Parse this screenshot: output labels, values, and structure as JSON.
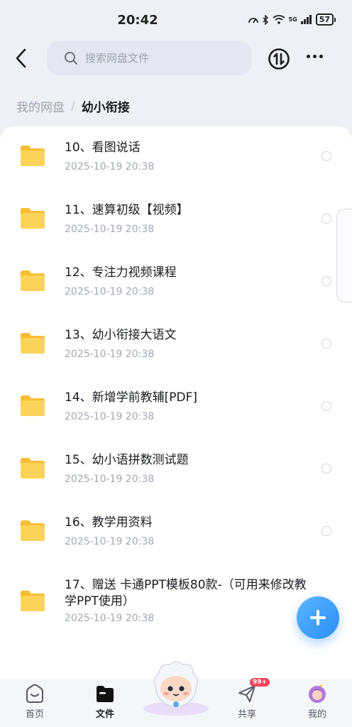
{
  "status": {
    "time": "20:42",
    "battery": "57",
    "network": "5G"
  },
  "search": {
    "placeholder": "搜索网盘文件"
  },
  "breadcrumb": {
    "root": "我的网盘",
    "separator": "/",
    "current": "幼小衔接"
  },
  "files": [
    {
      "name": "10、看图说话",
      "date": "2025-10-19  20:38"
    },
    {
      "name": "11、速算初级【视频】",
      "date": "2025-10-19  20:38"
    },
    {
      "name": "12、专注力视频课程",
      "date": "2025-10-19  20:38"
    },
    {
      "name": "13、幼小衔接大语文",
      "date": "2025-10-19  20:38"
    },
    {
      "name": "14、新增学前教辅[PDF]",
      "date": "2025-10-19  20:38"
    },
    {
      "name": "15、幼小语拼数测试题",
      "date": "2025-10-19  20:38"
    },
    {
      "name": "16、教学用资料",
      "date": "2025-10-19  20:38"
    },
    {
      "name": "17、赠送   卡通PPT模板80款-（可用来修改教学PPT使用）",
      "date": "2025-10-19  20:38"
    }
  ],
  "tabbar": {
    "home": "首页",
    "files": "文件",
    "share": "共享",
    "share_badge": "99+",
    "mine": "我的"
  },
  "colors": {
    "accent": "#2b8ff5",
    "folder": "#f8c73f",
    "badge": "#f0435a"
  }
}
